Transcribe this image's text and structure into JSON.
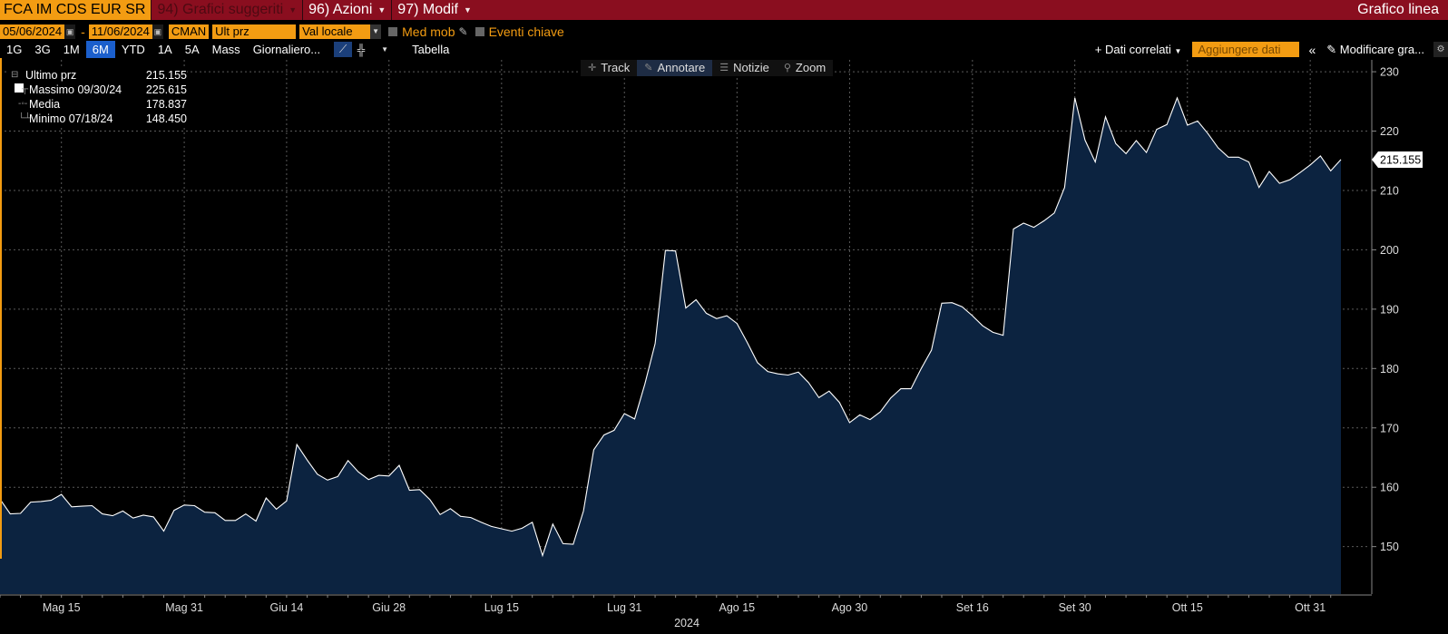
{
  "topbar": {
    "ticker": "FCA IM CDS EUR SR",
    "items": [
      {
        "label": "94) Grafici suggeriti",
        "dim": true
      },
      {
        "label": "96) Azioni",
        "dim": false
      },
      {
        "label": "97) Modif",
        "dim": false
      }
    ],
    "title": "Grafico linea"
  },
  "controls": {
    "start_date": "05/06/2024",
    "end_date": "11/06/2024",
    "source": "CMAN",
    "field": "Ult prz",
    "currency": "Val locale",
    "moving_avg": "Med mob",
    "key_events": "Eventi chiave"
  },
  "periods": [
    "1G",
    "3G",
    "1M",
    "6M",
    "YTD",
    "1A",
    "5A",
    "Mass",
    "Giornaliero..."
  ],
  "active_period": "6M",
  "table_label": "Tabella",
  "related_data": "+ Dati correlati",
  "add_data": "Aggiungere dati",
  "edit_chart": "Modificare gra...",
  "chart_tools": [
    "Track",
    "Annotare",
    "Notizie",
    "Zoom"
  ],
  "active_tool": "Annotare",
  "legend": [
    {
      "name": "Ultimo prz",
      "value": "215.155",
      "symbol": "box"
    },
    {
      "name": "Massimo 09/30/24",
      "value": "225.615",
      "symbol": "high"
    },
    {
      "name": "Media",
      "value": "178.837",
      "symbol": "avg"
    },
    {
      "name": "Minimo 07/18/24",
      "value": "148.450",
      "symbol": "low"
    }
  ],
  "colors": {
    "line": "#ffffff",
    "area": "#0c2340",
    "accent": "#f39c12",
    "topbar": "#8a0e1f"
  },
  "chart_data": {
    "type": "area",
    "ylim": [
      142,
      232
    ],
    "y_ticks": [
      150,
      160,
      170,
      180,
      190,
      200,
      210,
      220,
      230
    ],
    "x_tick_labels": [
      "Mag 15",
      "Mag 31",
      "Giu 14",
      "Giu 28",
      "Lug 15",
      "Lug 31",
      "Ago 15",
      "Ago 30",
      "Set 16",
      "Set 30",
      "Ott 15",
      "Ott 31"
    ],
    "x_tick_index": [
      6,
      18,
      28,
      38,
      49,
      61,
      72,
      83,
      95,
      105,
      116,
      128
    ],
    "year_label": "2024",
    "last_value_label": "215.155",
    "values": [
      158.0,
      155.5,
      155.6,
      157.5,
      157.6,
      157.8,
      158.8,
      156.7,
      156.8,
      156.9,
      155.5,
      155.2,
      156.0,
      154.8,
      155.3,
      155.0,
      152.6,
      156.1,
      157.0,
      156.9,
      155.8,
      155.7,
      154.4,
      154.4,
      155.5,
      154.3,
      158.2,
      156.3,
      157.7,
      167.2,
      164.6,
      162.2,
      161.2,
      161.8,
      164.5,
      162.6,
      161.3,
      162.0,
      161.9,
      163.7,
      159.5,
      159.6,
      157.9,
      155.4,
      156.4,
      155.1,
      154.9,
      154.1,
      153.4,
      153.0,
      152.6,
      153.1,
      154.1,
      148.5,
      153.8,
      150.5,
      150.4,
      156.0,
      166.3,
      168.8,
      169.6,
      172.4,
      171.5,
      177.4,
      184.2,
      199.9,
      199.8,
      190.2,
      191.6,
      189.3,
      188.4,
      188.9,
      187.6,
      184.4,
      181.0,
      179.5,
      179.1,
      178.9,
      179.4,
      177.6,
      175.1,
      176.2,
      174.3,
      170.9,
      172.2,
      171.4,
      172.7,
      175.0,
      176.6,
      176.6,
      180.0,
      183.1,
      191.0,
      191.1,
      190.4,
      188.9,
      187.2,
      186.1,
      185.6,
      203.5,
      204.5,
      203.8,
      204.9,
      206.2,
      210.5,
      225.6,
      218.5,
      214.8,
      222.4,
      217.9,
      216.2,
      218.4,
      216.4,
      220.3,
      221.1,
      225.6,
      221.0,
      221.7,
      219.6,
      217.2,
      215.6,
      215.6,
      214.8,
      210.5,
      213.2,
      211.2,
      211.8,
      213.0,
      214.3,
      215.8,
      213.3,
      215.2
    ]
  }
}
